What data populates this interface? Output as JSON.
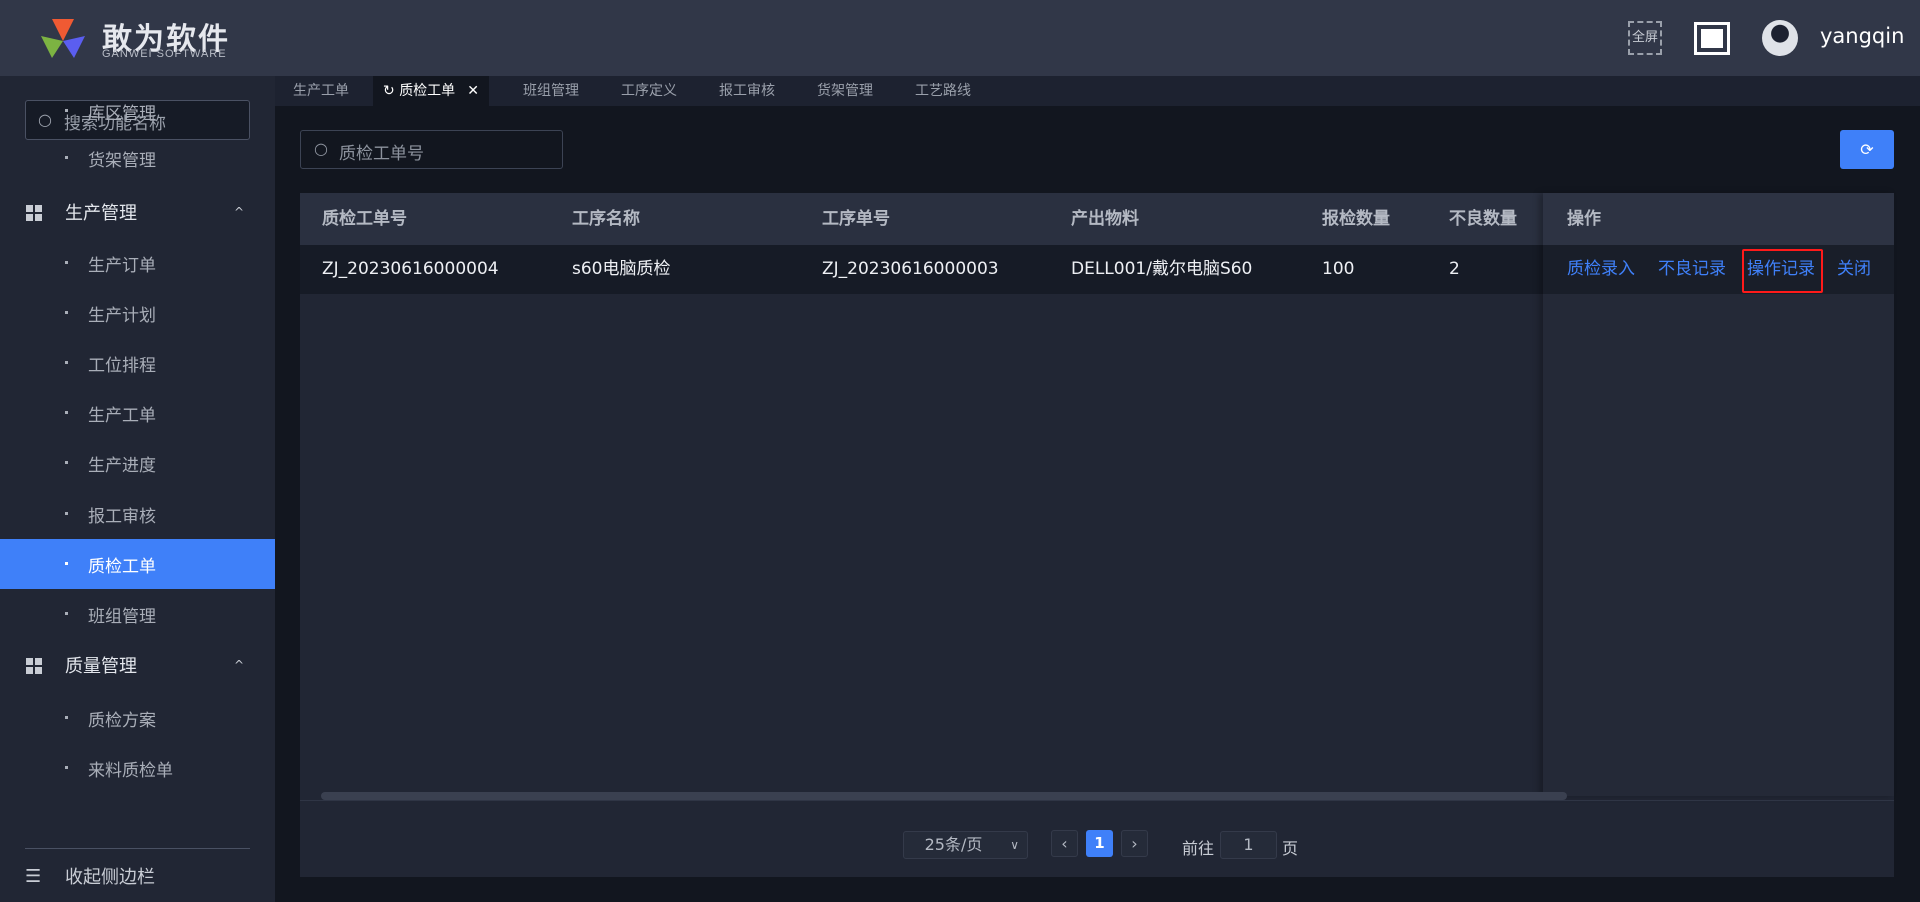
{
  "brand": {
    "name": "敢为软件",
    "sub": "GANWEI SOFTWARE",
    "colors": [
      "#f05a33",
      "#7cb342",
      "#5b5ef0"
    ]
  },
  "header": {
    "fullscreen_label": "全屏",
    "user": "yangqin"
  },
  "sidebar": {
    "search_placeholder": "搜索功能名称",
    "items": [
      {
        "label": "库区管理",
        "type": "sub"
      },
      {
        "label": "货架管理",
        "type": "sub"
      },
      {
        "label": "生产管理",
        "type": "group"
      },
      {
        "label": "生产订单",
        "type": "sub"
      },
      {
        "label": "生产计划",
        "type": "sub"
      },
      {
        "label": "工位排程",
        "type": "sub"
      },
      {
        "label": "生产工单",
        "type": "sub"
      },
      {
        "label": "生产进度",
        "type": "sub"
      },
      {
        "label": "报工审核",
        "type": "sub"
      },
      {
        "label": "质检工单",
        "type": "sub",
        "active": true
      },
      {
        "label": "班组管理",
        "type": "sub"
      },
      {
        "label": "质量管理",
        "type": "group"
      },
      {
        "label": "质检方案",
        "type": "sub"
      },
      {
        "label": "来料质检单",
        "type": "sub"
      }
    ],
    "collapse_label": "收起侧边栏"
  },
  "tabs": [
    {
      "label": "生产工单"
    },
    {
      "label": "质检工单",
      "active": true
    },
    {
      "label": "班组管理"
    },
    {
      "label": "工序定义"
    },
    {
      "label": "报工审核"
    },
    {
      "label": "货架管理"
    },
    {
      "label": "工艺路线"
    }
  ],
  "search": {
    "placeholder": "质检工单号"
  },
  "table": {
    "columns": [
      "质检工单号",
      "工序名称",
      "工序单号",
      "产出物料",
      "报检数量",
      "不良数量",
      "操作"
    ],
    "rows": [
      {
        "cells": [
          "ZJ_20230616000004",
          "s60电脑质检",
          "ZJ_20230616000003",
          "DELL001/戴尔电脑S60",
          "100",
          "2"
        ],
        "actions": [
          "质检录入",
          "不良记录",
          "操作记录",
          "关闭"
        ]
      }
    ]
  },
  "pagination": {
    "page_size": "25条/页",
    "current_page": "1",
    "goto_label": "前往",
    "goto_value": "1",
    "page_suffix": "页"
  },
  "accent": "#3f80f9"
}
